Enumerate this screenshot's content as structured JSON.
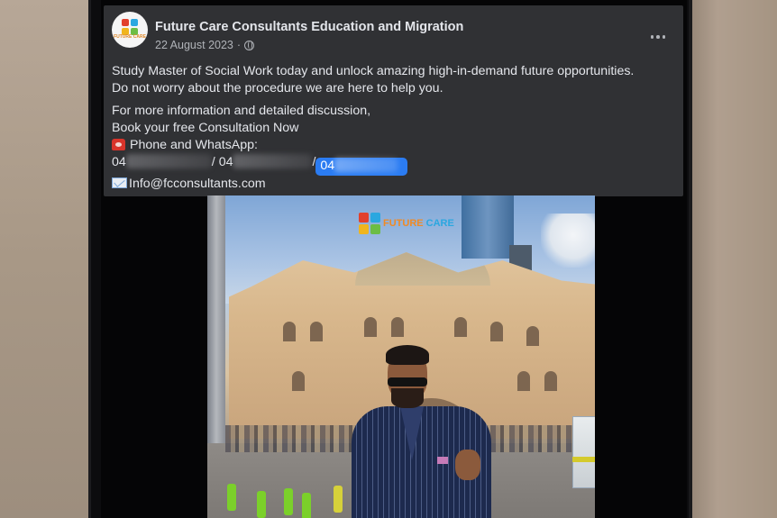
{
  "post": {
    "page_name": "Future Care Consultants Education and Migration",
    "date": "22 August 2023",
    "meta_separator": "·",
    "lines": {
      "intro_1": "Study Master of Social Work today and unlock amazing high-in-demand future opportunities.",
      "intro_2": "Do not worry about the procedure we are here to help you.",
      "more_info": "For more information and detailed discussion,",
      "book": "Book your free Consultation Now",
      "phone_label": "Phone and WhatsApp:",
      "phone_1": "04",
      "phone_sep": "/",
      "phone_2": "04",
      "phone_3": "04",
      "email": "Info@fcconsultants.com"
    },
    "avatar_text": "FUTURE CARE",
    "icons": {
      "more": "more-options-icon",
      "audience": "globe-icon",
      "phone_emoji": "telephone-icon",
      "email_emoji": "envelope-icon"
    }
  },
  "video": {
    "watermark_word1": "FUTURE",
    "watermark_word2": "CARE"
  },
  "colors": {
    "card_bg": "#303134",
    "text_primary": "#e4e6eb",
    "text_secondary": "#b0b3b8",
    "highlight_blue": "#2b7cf2",
    "brand_orange": "#f08a24",
    "brand_blue": "#2aa7e0"
  }
}
